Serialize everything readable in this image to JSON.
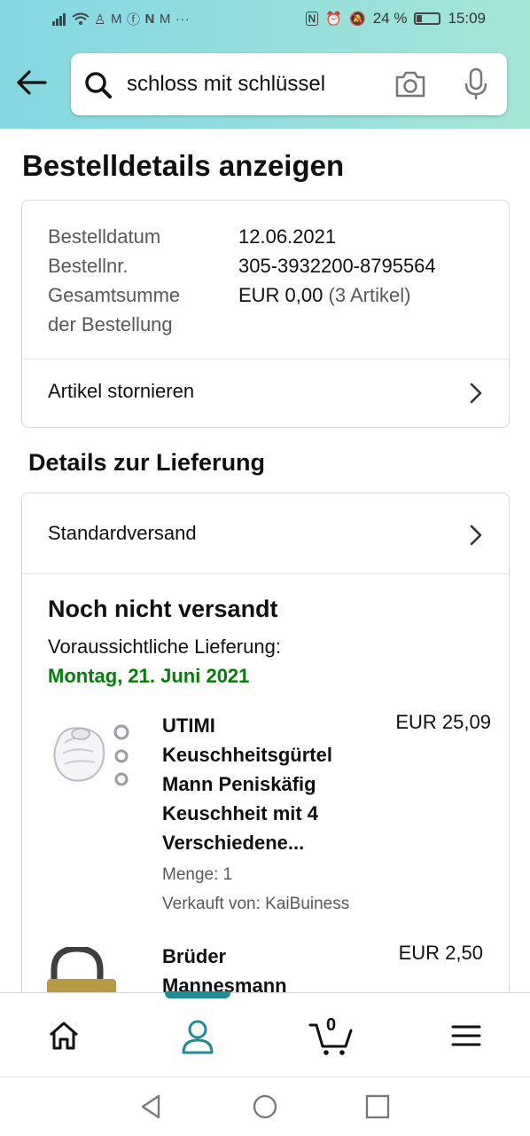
{
  "status_bar": {
    "left_icons": [
      "signal-icon",
      "wifi-icon",
      "playstation-icon",
      "gmail-icon",
      "facebook-icon",
      "n-app-icon",
      "gmail-icon"
    ],
    "more": "···",
    "battery_percent": "24 %",
    "time": "15:09"
  },
  "search": {
    "query": "schloss mit schlüssel"
  },
  "page": {
    "title": "Bestelldetails anzeigen"
  },
  "order_info": {
    "rows": [
      {
        "label": "Bestelldatum",
        "value": "12.06.2021"
      },
      {
        "label": "Bestellnr.",
        "value": "305-3932200-8795564"
      }
    ],
    "total_label_line1": "Gesamtsumme",
    "total_label_line2": "der Bestellung",
    "total_value": "EUR 0,00",
    "total_count": "(3 Artikel)",
    "cancel_label": "Artikel stornieren"
  },
  "delivery": {
    "section_title": "Details zur Lieferung",
    "shipping_method": "Standardversand",
    "status": "Noch nicht versandt",
    "estimate_label": "Voraussichtliche Lieferung:",
    "estimate_date": "Montag, 21. Juni 2021",
    "date_color": "#067d0b"
  },
  "items": [
    {
      "title_lines": [
        "UTIMI",
        "Keuschheitsgürtel",
        "Mann Peniskäfig",
        "Keuschheit mit 4",
        "Verschiedene..."
      ],
      "price": "EUR 25,09",
      "quantity": "Menge: 1",
      "seller": "Verkauft von: KaiBuiness"
    },
    {
      "title_lines": [
        "Brüder",
        "Mannesmann"
      ],
      "price": "EUR 2,50"
    }
  ],
  "bottom_nav": {
    "items": [
      "home-icon",
      "account-icon",
      "cart-icon",
      "menu-icon"
    ],
    "cart_count": "0",
    "accent": "#1f8c96"
  }
}
